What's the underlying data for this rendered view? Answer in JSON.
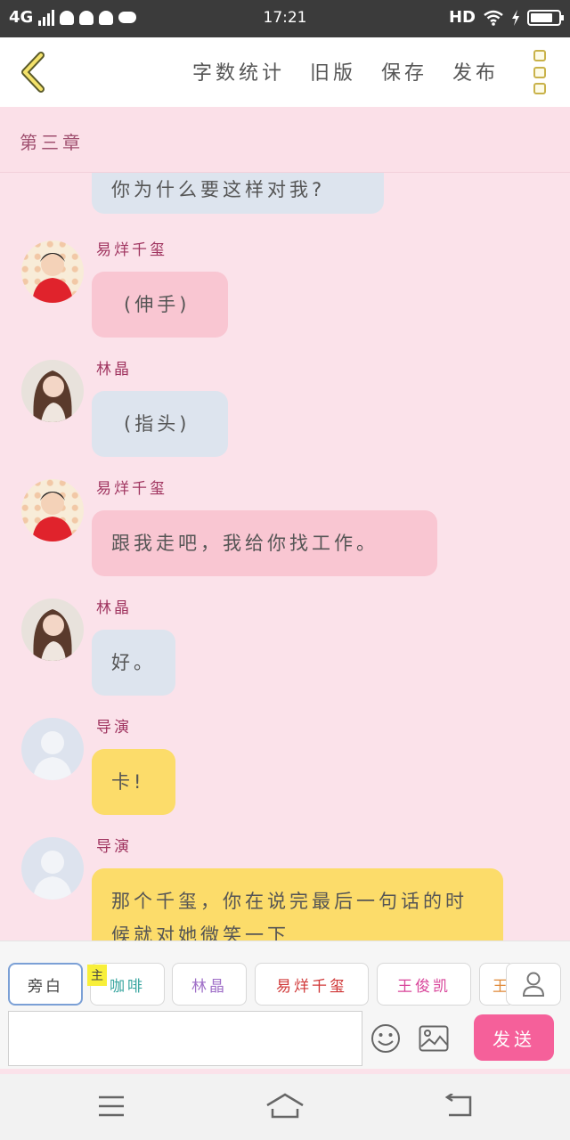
{
  "status_bar": {
    "network": "4G",
    "time": "17:21",
    "hd": "HD"
  },
  "toolbar": {
    "word_count": "字数统计",
    "old_version": "旧版",
    "save": "保存",
    "publish": "发布"
  },
  "chapter": {
    "title": "第三章"
  },
  "messages": [
    {
      "speaker": "",
      "text": "你为什么要这样对我?",
      "style": "blue"
    },
    {
      "speaker": "易烊千玺",
      "text": "(伸手)",
      "style": "pink"
    },
    {
      "speaker": "林晶",
      "text": "(指头)",
      "style": "blue"
    },
    {
      "speaker": "易烊千玺",
      "text": "跟我走吧，我给你找工作。",
      "style": "pink"
    },
    {
      "speaker": "林晶",
      "text": "好。",
      "style": "blue"
    },
    {
      "speaker": "导演",
      "text": "卡!",
      "style": "yellow"
    },
    {
      "speaker": "导演",
      "text": "那个千玺，你在说完最后一句话的时候就对她微笑一下",
      "style": "yellow"
    }
  ],
  "composer": {
    "main_tag": "主",
    "roles": [
      {
        "label": "旁白",
        "color": "#444444"
      },
      {
        "label": "咖啡",
        "color": "#3aa6a0"
      },
      {
        "label": "林晶",
        "color": "#a070c8"
      },
      {
        "label": "易烊千玺",
        "color": "#d03838"
      },
      {
        "label": "王俊凯",
        "color": "#d8459a"
      },
      {
        "label": "王",
        "color": "#e08a3a"
      }
    ],
    "input_value": "",
    "send_label": "发送"
  },
  "colors": {
    "background": "#fbe2ea",
    "bubble_pink": "#f9c6d2",
    "bubble_blue": "#dde4ee",
    "bubble_yellow": "#fcdc6a",
    "send_button": "#f5609a",
    "speaker_name": "#a03560"
  },
  "icons": [
    "back-chevron-icon",
    "more-menu-icon",
    "person-icon",
    "emoji-icon",
    "image-icon",
    "menu-icon",
    "home-icon",
    "return-icon"
  ]
}
